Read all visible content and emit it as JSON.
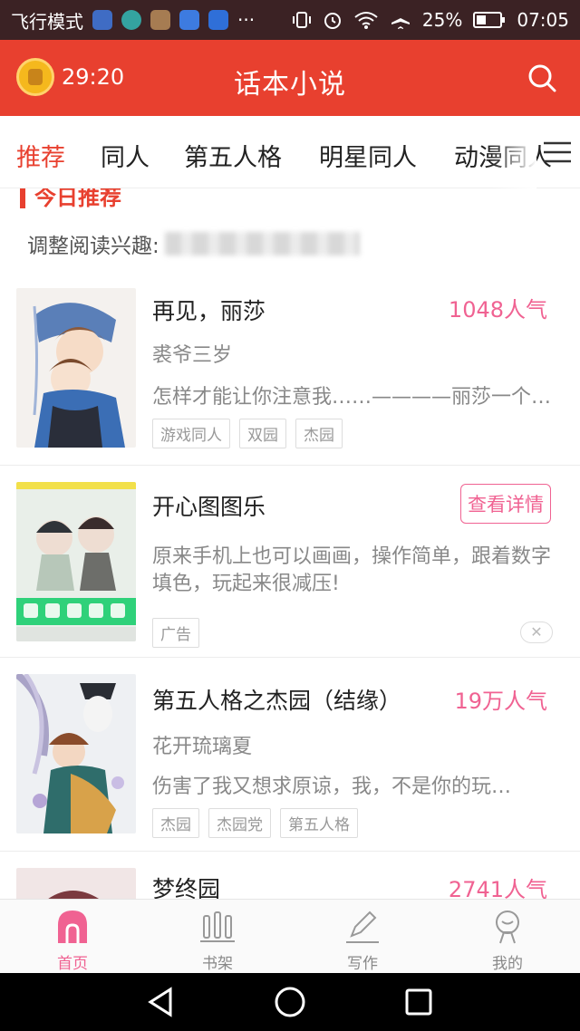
{
  "status_bar": {
    "mode": "飞行模式",
    "dots": "···",
    "battery": "25%",
    "time": "07:05"
  },
  "header": {
    "timer": "29:20",
    "title": "话本小说"
  },
  "tabs": [
    "推荐",
    "同人",
    "第五人格",
    "明星同人",
    "动漫同人"
  ],
  "feed": {
    "section_title": "今日推荐",
    "adjust_label": "调整阅读兴趣:",
    "items": [
      {
        "title": "再见，丽莎",
        "popularity": "1048人气",
        "author": "裘爷三岁",
        "desc": "怎样才能让你注意我……————丽莎一个…",
        "tags": [
          "游戏同人",
          "双园",
          "杰园"
        ]
      },
      {
        "title": "开心图图乐",
        "button": "查看详情",
        "desc": "原来手机上也可以画画，操作简单，跟着数字填色，玩起来很减压!",
        "ad_label": "广告",
        "close": "✕"
      },
      {
        "title": "第五人格之杰园（结缘）",
        "popularity": "19万人气",
        "author": "花开琉璃夏",
        "desc": "伤害了我又想求原谅，我，不是你的玩…",
        "tags": [
          "杰园",
          "杰园党",
          "第五人格"
        ]
      },
      {
        "title": "梦终园",
        "popularity": "2741人气"
      }
    ]
  },
  "bottom_nav": [
    {
      "label": "首页",
      "icon": "home-icon",
      "active": true
    },
    {
      "label": "书架",
      "icon": "bookshelf-icon",
      "active": false
    },
    {
      "label": "写作",
      "icon": "pen-icon",
      "active": false
    },
    {
      "label": "我的",
      "icon": "profile-icon",
      "active": false
    }
  ],
  "colors": {
    "brand_red": "#e8402f",
    "pink": "#f06292",
    "status_bar": "#3b2224"
  }
}
